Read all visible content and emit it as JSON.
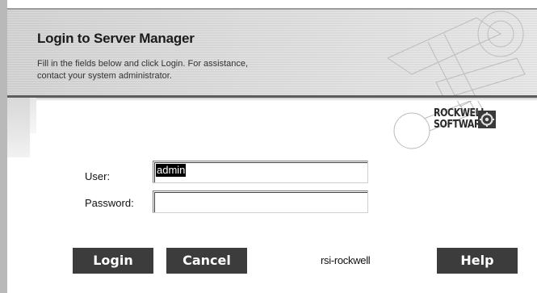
{
  "header": {
    "title": "Login to Server Manager",
    "subtitle_line1": "Fill in the fields below and click Login. For assistance,",
    "subtitle_line2": "contact your system administrator."
  },
  "logo": {
    "line1": "ROCKWELL",
    "line2": "SOFTWARE",
    "icon": "rockwell-gear-icon"
  },
  "form": {
    "user_label": "User:",
    "user_value": "admin",
    "password_label": "Password:",
    "password_value": ""
  },
  "buttons": {
    "login": "Login",
    "cancel": "Cancel",
    "help": "Help"
  },
  "server_name": "rsi-rockwell",
  "colors": {
    "button_bg": "#3c3c3c",
    "header_bg": "#dedede"
  }
}
